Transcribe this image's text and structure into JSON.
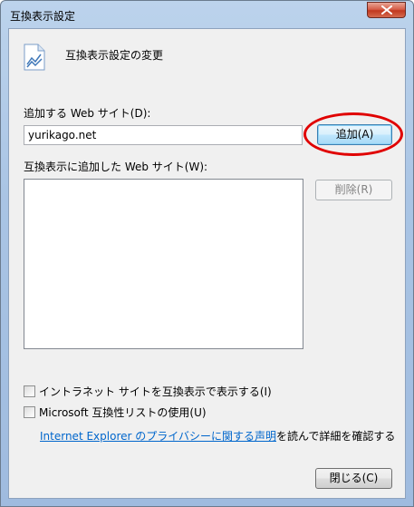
{
  "window": {
    "title": "互換表示設定"
  },
  "header": {
    "title": "互換表示設定の変更",
    "icon": "document-chart-icon"
  },
  "add_section": {
    "label": "追加する Web サイト(D):",
    "input_value": "yurikago.net",
    "add_button": "追加(A)"
  },
  "list_section": {
    "label": "互換表示に追加した Web サイト(W):",
    "items": [],
    "remove_button": "削除(R)"
  },
  "options": {
    "intranet": {
      "label": "イントラネット サイトを互換表示で表示する(I)",
      "checked": false
    },
    "microsoft_list": {
      "label": "Microsoft 互換性リストの使用(U)",
      "checked": false
    }
  },
  "privacy": {
    "link_text": "Internet Explorer のプライバシーに関する声明",
    "trailing_text": "を読んで詳細を確認する"
  },
  "footer": {
    "close_button": "閉じる(C)"
  },
  "colors": {
    "annotation": "#e00000",
    "link": "#0066cc"
  }
}
